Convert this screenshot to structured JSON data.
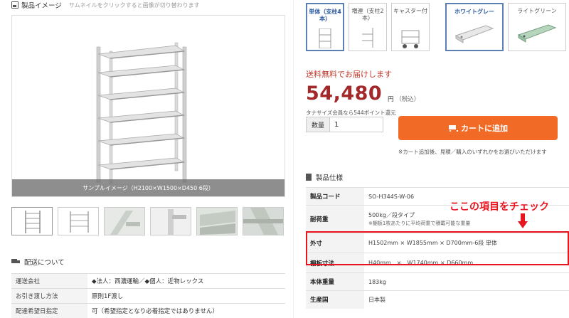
{
  "gallery": {
    "title": "製品イメージ",
    "hint": "サムネイルをクリックすると画像が切り替わります",
    "main_caption": "サンプルイメージ（H2100×W1500×D450 6段）",
    "thumbnails": [
      "thumb-1",
      "thumb-2",
      "thumb-3",
      "thumb-4",
      "thumb-5",
      "thumb-6"
    ]
  },
  "delivery": {
    "title": "配送について",
    "rows": [
      {
        "label": "運送会社",
        "value": "◆法人：西濃運輸／◆個人：近物レックス"
      },
      {
        "label": "お引き渡し方法",
        "value": "原則1F渡し"
      },
      {
        "label": "配達希望日指定",
        "value": "可（希望指定となり必着指定ではありません）"
      }
    ]
  },
  "options": {
    "type": [
      {
        "label": "単体（支柱4本）",
        "selected": true
      },
      {
        "label": "増連（支柱2本）",
        "selected": false
      },
      {
        "label": "キャスター付",
        "selected": false
      }
    ],
    "color": [
      {
        "label": "ホワイトグレー",
        "selected": true
      },
      {
        "label": "ライトグリーン",
        "selected": false
      }
    ]
  },
  "pricing": {
    "free_shipping": "送料無料でお届けします",
    "price": "54,480",
    "unit": "円",
    "tax_note": "（税込）",
    "points_note": "タナサイズ会員なら544ポイント還元"
  },
  "cart": {
    "qty_label": "数量",
    "qty_value": "1",
    "button_label": "カートに追加",
    "note": "※カート追加後、見積／購入のいずれかをお選びいただけます"
  },
  "specs": {
    "title": "製品仕様",
    "rows": [
      {
        "label": "製品コード",
        "value": "SO-H344S-W-06"
      },
      {
        "label": "耐荷重",
        "value": "500kg／段タイプ",
        "sub": "※棚板1枚あたりに平均荷重で積載可能な重量"
      },
      {
        "label": "外寸",
        "value": "H1502mm × W1855mm × D700mm-6段 単体"
      },
      {
        "label": "棚板寸法",
        "value": "H40mm　×　W1740mm × D660mm"
      },
      {
        "label": "本体重量",
        "value": "183kg"
      },
      {
        "label": "生産国",
        "value": "日本製"
      }
    ]
  },
  "annotation": "ここの項目をチェック",
  "colors": {
    "price": "#a3282a",
    "cart_button": "#f26b26",
    "highlight": "#e8141e",
    "selected_border": "#5b7fb0"
  }
}
